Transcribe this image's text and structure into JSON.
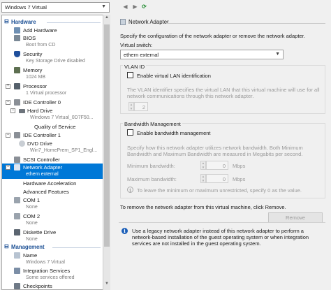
{
  "toolbar": {
    "vm_name": "Windows 7 Virtual"
  },
  "tree": {
    "hardware_header": "Hardware",
    "management_header": "Management",
    "items": [
      {
        "title": "Add Hardware",
        "sub": ""
      },
      {
        "title": "BIOS",
        "sub": "Boot from CD"
      },
      {
        "title": "Security",
        "sub": "Key Storage Drive disabled"
      },
      {
        "title": "Memory",
        "sub": "1024 MB"
      },
      {
        "title": "Processor",
        "sub": "1 Virtual processor"
      },
      {
        "title": "IDE Controller 0",
        "sub": ""
      },
      {
        "title": "Hard Drive",
        "sub": "Windows 7 Virtual_0D7F50..."
      },
      {
        "title": "Quality of Service",
        "sub": ""
      },
      {
        "title": "IDE Controller 1",
        "sub": ""
      },
      {
        "title": "DVD Drive",
        "sub": "Win7_HomePrem_SP1_Engl..."
      },
      {
        "title": "SCSI Controller",
        "sub": ""
      },
      {
        "title": "Network Adapter",
        "sub": "ethern external"
      },
      {
        "title": "Hardware Acceleration",
        "sub": ""
      },
      {
        "title": "Advanced Features",
        "sub": ""
      },
      {
        "title": "COM 1",
        "sub": "None"
      },
      {
        "title": "COM 2",
        "sub": "None"
      },
      {
        "title": "Diskette Drive",
        "sub": "None"
      },
      {
        "title": "Name",
        "sub": "Windows 7 Virtual"
      },
      {
        "title": "Integration Services",
        "sub": "Some services offered"
      },
      {
        "title": "Checkpoints",
        "sub": ""
      }
    ]
  },
  "panel": {
    "header": "Network Adapter",
    "description": "Specify the configuration of the network adapter or remove the network adapter.",
    "virtual_switch_label": "Virtual switch:",
    "virtual_switch_value": "ethern external",
    "vlan": {
      "title": "VLAN ID",
      "checkbox_label": "Enable virtual LAN identification",
      "desc_line1": "The VLAN identifier specifies the virtual LAN that this virtual machine will use for all",
      "desc_line2": "network communications through this network adapter.",
      "value": "2"
    },
    "bandwidth": {
      "title": "Bandwidth Management",
      "checkbox_label": "Enable bandwidth management",
      "desc_line1": "Specify how this network adapter utilizes network bandwidth. Both Minimum",
      "desc_line2": "Bandwidth and Maximum Bandwidth are measured in Megabits per second.",
      "min_label": "Minimum bandwidth:",
      "min_value": "0",
      "min_unit": "Mbps",
      "max_label": "Maximum bandwidth:",
      "max_value": "0",
      "max_unit": "Mbps",
      "hint": "To leave the minimum or maximum unrestricted, specify 0 as the value."
    },
    "remove_text": "To remove the network adapter from this virtual machine, click Remove.",
    "remove_button": "Remove",
    "legacy_line1": "Use a legacy network adapter instead of this network adapter to perform a",
    "legacy_line2": "network-based installation of the guest operating system or when integration",
    "legacy_line3": "services are not installed in the guest operating system."
  }
}
